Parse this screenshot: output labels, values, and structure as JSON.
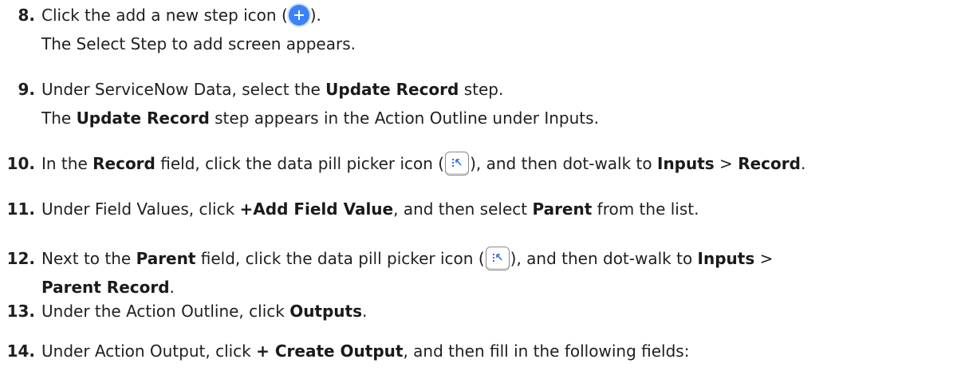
{
  "steps": [
    {
      "number": "8.",
      "lines": [
        [
          "Click the add a new step icon (",
          {
            "icon": "add-step-icon"
          },
          ")."
        ],
        [
          "The Select Step to add screen appears."
        ]
      ]
    },
    {
      "number": "9.",
      "lines": [
        [
          "Under ServiceNow Data, select the ",
          {
            "bold": "Update Record"
          },
          " step."
        ],
        [
          "The ",
          {
            "bold": "Update Record"
          },
          " step appears in the Action Outline under Inputs."
        ]
      ]
    },
    {
      "number": "10.",
      "lines": [
        [
          "In the ",
          {
            "bold": "Record"
          },
          " field, click the data pill picker icon (",
          {
            "icon": "data-pill-picker-icon"
          },
          "), and then dot-walk to ",
          {
            "bold": "Inputs"
          },
          " > ",
          {
            "bold": "Record"
          },
          "."
        ]
      ]
    },
    {
      "number": "11.",
      "lines": [
        [
          "Under Field Values, click ",
          {
            "bold": "+Add Field Value"
          },
          ", and then select ",
          {
            "bold": "Parent"
          },
          " from the list."
        ]
      ]
    },
    {
      "number": "12.",
      "lines": [
        [
          "Next to the ",
          {
            "bold": "Parent"
          },
          " field, click the data pill picker icon (",
          {
            "icon": "data-pill-picker-icon"
          },
          "), and then dot-walk to ",
          {
            "bold": "Inputs"
          },
          " >"
        ],
        [
          {
            "bold": "Parent Record"
          },
          "."
        ]
      ]
    },
    {
      "number": "13.",
      "lines": [
        [
          "Under the Action Outline, click ",
          {
            "bold": "Outputs"
          },
          "."
        ]
      ]
    },
    {
      "number": "14.",
      "lines": [
        [
          "Under Action Output, click ",
          {
            "bold": "+ Create Output"
          },
          ", and then fill in the following fields:"
        ]
      ]
    }
  ],
  "colors": {
    "text": "#1f1f1f",
    "add_icon": "#3b82f6"
  }
}
